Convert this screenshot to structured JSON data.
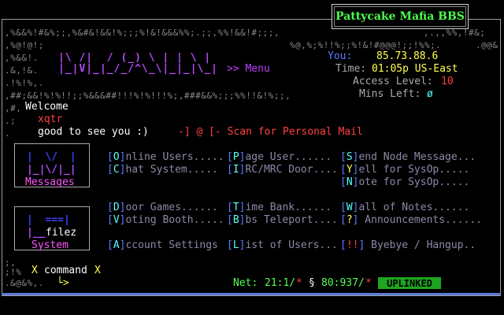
{
  "bbs": {
    "title": "Pattycake Mafia BBS"
  },
  "noise": {
    "r1": ",%&&%!#&%;;,%&#&!&&!%;;;%!&!&&&%%;.;;,%%!&&!#;;;,",
    "r1b": ",.,,%%,!#&;",
    "r2": ",%@!@!;",
    "r2b": "%@,%;%!!%;;%!&!#@@@!;;!%%;.",
    "r2c": ".@@&",
    "r3": ",%&&!.",
    "r4": ".&,!&.",
    "r5": ".!%!%,.",
    "r6": ",##;&&!%!%!!;;%&&&##!!!%!%!!!%;,###&&%;;;%%!!&!%;;,",
    "r7": ",#,",
    "r8": ".;",
    "r9": ".",
    "r10": ".;",
    "r11": ";,",
    "r12": ";!%",
    "r13": ".&@&%,."
  },
  "logo": {
    "line1": "|\\ /|  / (_) \\ | | \\ |",
    "line2": "|_|V|_|_/_/^\\_\\|_|_|\\_|",
    "menu_label": ">> Menu"
  },
  "info": {
    "you_label": "You:",
    "you_value": "85.73.88.6",
    "time_label": "Time:",
    "time_value": "01:05p US-East",
    "access_label": "Access Level:",
    "access_value": "10",
    "mins_label": "Mins Left:",
    "mins_value": "ø"
  },
  "greeting": {
    "welcome": "Welcome",
    "username": "xqtr",
    "good_to_see": "good to see you :)",
    "scan_text": "-] @ [- Scan for Personal Mail"
  },
  "sections": {
    "messages_label": "Messages",
    "system_label": "System",
    "filez_label": "filez"
  },
  "menu": {
    "row1": [
      {
        "key": "O",
        "text": "nline Users....."
      },
      {
        "key": "P",
        "text": "age User......"
      },
      {
        "key": "S",
        "text": "end Node Message..."
      }
    ],
    "row2": [
      {
        "key": "C",
        "text": "hat System....."
      },
      {
        "key": "I",
        "text": "RC/MRC Door...."
      },
      {
        "key": "Y",
        "text": "ell for SysOp....."
      }
    ],
    "row3": [
      {
        "key": "N",
        "text": "ote for SysOp....."
      }
    ],
    "row4": [
      {
        "key": "D",
        "text": "oor Games......"
      },
      {
        "key": "T",
        "text": "ime Bank......"
      },
      {
        "key": "W",
        "text": "all of Notes......"
      }
    ],
    "row5": [
      {
        "key": "V",
        "text": "oting Booth....."
      },
      {
        "key": "B",
        "text": "bs Teleport...."
      },
      {
        "key": "?",
        "text": " Announcements......"
      }
    ],
    "row6": [
      {
        "key": "A",
        "text": "ccount Settings"
      },
      {
        "key": "L",
        "text": "ist of Users..."
      },
      {
        "key": "!!",
        "text": " Byebye / Hangup.."
      }
    ]
  },
  "command": {
    "x_left": "X",
    "label": "command",
    "x_right": "X",
    "prompt": "└>"
  },
  "status": {
    "net_label": "Net:",
    "net_value": "21:1/",
    "net_star": "*",
    "section_sym": "§",
    "node_value": "80:937/",
    "node_star": "*",
    "uplinked": "UPLINKED"
  }
}
